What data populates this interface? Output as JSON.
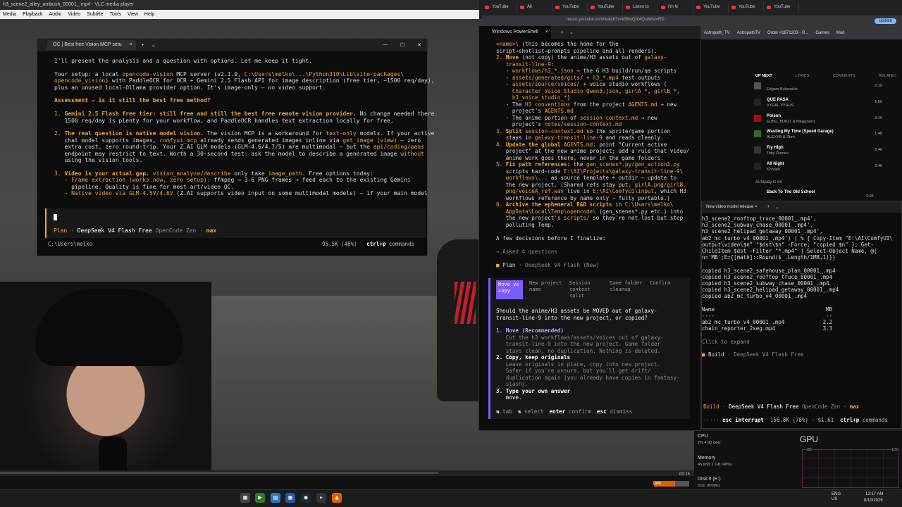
{
  "vlc": {
    "title": "h3_scene2_alley_ambush_00001_.mp4 - VLC media player",
    "menu": [
      "Media",
      "Playback",
      "Audio",
      "Video",
      "Subtitle",
      "Tools",
      "View",
      "Help"
    ],
    "time": "00:15",
    "volume": "100%"
  },
  "oc_window": {
    "tab": "OC | Best free Vision MCP setu",
    "body": [
      [
        {
          "t": "I'll present the analysis and a question with options. Let me keep it tight.",
          "c": ""
        }
      ],
      [
        {
          "t": "",
          "c": ""
        }
      ],
      [
        {
          "t": "Your setup: a local ",
          "c": ""
        },
        {
          "t": "opencode-vision",
          "c": "o"
        },
        {
          "t": " MCP server (v2.1.0, ",
          "c": ""
        },
        {
          "t": "C:\\Users\\melko\\...\\Python310\\Lib\\site-packages\\",
          "c": "o"
        }
      ],
      [
        {
          "t": "opencode_vision",
          "c": "o"
        },
        {
          "t": ") with PaddleOCR for OCR + Gemini 2.5 Flash API for image description (free tier, ~1500 req/day),",
          "c": ""
        }
      ],
      [
        {
          "t": "plus an unused local-Ollama provider option. It's image-only — no video support.",
          "c": ""
        }
      ],
      [
        {
          "t": "",
          "c": ""
        }
      ],
      [
        {
          "t": "Assessment — is it still the best free method?",
          "c": "o b"
        }
      ],
      [
        {
          "t": "",
          "c": ""
        }
      ],
      [
        {
          "t": "1. ",
          "c": "o"
        },
        {
          "t": "Gemini 2.5 Flash free tier: still free and still the best free remote vision provider.",
          "c": "o b"
        },
        {
          "t": " No change needed there.",
          "c": ""
        }
      ],
      [
        {
          "t": "   1500 req/day is plenty for your workflow, and PaddleOCR handles text extraction locally for free.",
          "c": ""
        }
      ],
      [
        {
          "t": "",
          "c": ""
        }
      ],
      [
        {
          "t": "2. ",
          "c": "o"
        },
        {
          "t": "The real question is native model vision.",
          "c": "o b"
        },
        {
          "t": " The vision MCP is a workaround for ",
          "c": ""
        },
        {
          "t": "text-only",
          "c": "o"
        },
        {
          "t": " models. If your active",
          "c": ""
        }
      ],
      [
        {
          "t": "   chat model supports images, ",
          "c": ""
        },
        {
          "t": "comfyui_mcp",
          "c": "o"
        },
        {
          "t": " already sends generated images inline via ",
          "c": ""
        },
        {
          "t": "get_image (view)",
          "c": "o"
        },
        {
          "t": " — zero",
          "c": ""
        }
      ],
      [
        {
          "t": "   extra cost, zero round-trip. Your Z.AI GLM models (GLM-4.6/4.7/5) are multimodal — but the ",
          "c": ""
        },
        {
          "t": "api/coding/paas",
          "c": "o"
        }
      ],
      [
        {
          "t": "   endpoint may restrict to text. Worth a 30-second test: ask the model to describe a generated image ",
          "c": ""
        },
        {
          "t": "without",
          "c": "o"
        }
      ],
      [
        {
          "t": "   using the vision tools.",
          "c": ""
        }
      ],
      [
        {
          "t": "",
          "c": ""
        }
      ],
      [
        {
          "t": "3. ",
          "c": "o"
        },
        {
          "t": "Video is your actual gap.",
          "c": "o b"
        },
        {
          "t": " ",
          "c": ""
        },
        {
          "t": "vision_analyze/describe",
          "c": "o"
        },
        {
          "t": " only take ",
          "c": ""
        },
        {
          "t": "image_path",
          "c": "o"
        },
        {
          "t": ". Free options today:",
          "c": ""
        }
      ],
      [
        {
          "t": "   - ",
          "c": ""
        },
        {
          "t": "Frame extraction (works now, zero setup):",
          "c": "o"
        },
        {
          "t": " ffmpeg → 3-6 PNG frames → feed each to the existing Gemini",
          "c": ""
        }
      ],
      [
        {
          "t": "     pipeline. Quality is fine for most art/video QC.",
          "c": ""
        }
      ],
      [
        {
          "t": "   - ",
          "c": ""
        },
        {
          "t": "Native video via GLM-4.5V/4.6V",
          "c": "o"
        },
        {
          "t": " (Z.AI supports video input on some multimodal models) — if your main model",
          "c": ""
        }
      ]
    ],
    "mode": "Plan",
    "model": "DeepSeek V4 Flash Free",
    "provider": "OpenCode Zen",
    "variant": "max",
    "cwd": "C:\\Users\\melko",
    "context": "95.5K (48%)",
    "shortcut": "ctrl+p",
    "shortcut_label": "commands"
  },
  "ps_window": {
    "tab": "Windows PowerShell",
    "body": [
      [
        {
          "t": "<name>\\",
          "c": "o"
        },
        {
          "t": " (this becomes the home for the",
          "c": ""
        }
      ],
      [
        {
          "t": "script→shotlist→prompts pipeline and all renders).",
          "c": ""
        }
      ],
      [
        {
          "t": "2. ",
          "c": "o"
        },
        {
          "t": "Move",
          "c": "o b"
        },
        {
          "t": " (not copy) the anime/H3 assets out of ",
          "c": ""
        },
        {
          "t": "galaxy-",
          "c": "o"
        }
      ],
      [
        {
          "t": "   transit-line-9",
          "c": "o"
        },
        {
          "t": ":",
          "c": ""
        }
      ],
      [
        {
          "t": "   - ",
          "c": ""
        },
        {
          "t": "workflows/h3_*.json",
          "c": "o"
        },
        {
          "t": " → the 6 H3 build/run/qa scripts",
          "c": ""
        }
      ],
      [
        {
          "t": "   - ",
          "c": ""
        },
        {
          "t": "assets/generated/gits/",
          "c": "o"
        },
        {
          "t": " + ",
          "c": ""
        },
        {
          "t": "h3_*.mp4",
          "c": "o"
        },
        {
          "t": " test outputs",
          "c": ""
        }
      ],
      [
        {
          "t": "   - ",
          "c": ""
        },
        {
          "t": "assets/source/voices/",
          "c": "o"
        },
        {
          "t": " + voice studio workflows (",
          "c": ""
        }
      ],
      [
        {
          "t": "     Character_Voice_Studio_Qwen3.json",
          "c": "o"
        },
        {
          "t": ", ",
          "c": ""
        },
        {
          "t": "girlA_*",
          "c": "o"
        },
        {
          "t": ", ",
          "c": ""
        },
        {
          "t": "girlB_*",
          "c": "o"
        },
        {
          "t": ",",
          "c": ""
        }
      ],
      [
        {
          "t": "     h3_voice_studio_*",
          "c": "o"
        },
        {
          "t": ")",
          "c": ""
        }
      ],
      [
        {
          "t": "   - The ",
          "c": ""
        },
        {
          "t": "H3 conventions",
          "c": "o"
        },
        {
          "t": " from the project ",
          "c": ""
        },
        {
          "t": "AGENTS.md",
          "c": "o"
        },
        {
          "t": " → new",
          "c": ""
        }
      ],
      [
        {
          "t": "     project's ",
          "c": ""
        },
        {
          "t": "AGENTS.md",
          "c": "o"
        }
      ],
      [
        {
          "t": "   - The anime portion of ",
          "c": ""
        },
        {
          "t": "session-context.md",
          "c": "o"
        },
        {
          "t": " → new",
          "c": ""
        }
      ],
      [
        {
          "t": "     project's ",
          "c": ""
        },
        {
          "t": "notes/session-context.md",
          "c": "o"
        }
      ],
      [
        {
          "t": "3. ",
          "c": "o"
        },
        {
          "t": "Split ",
          "c": "o b"
        },
        {
          "t": "session-context.md",
          "c": "o"
        },
        {
          "t": " so the sprite/game portion",
          "c": ""
        }
      ],
      [
        {
          "t": "   stays in ",
          "c": ""
        },
        {
          "t": "galaxy-transit-line-9",
          "c": "o"
        },
        {
          "t": " and reads cleanly.",
          "c": ""
        }
      ],
      [
        {
          "t": "4. ",
          "c": "o"
        },
        {
          "t": "Update the global ",
          "c": "o b"
        },
        {
          "t": "AGENTS.md",
          "c": "o"
        },
        {
          "t": ": point \"Current active",
          "c": ""
        }
      ],
      [
        {
          "t": "   project\" at the new anime project; add a rule that video/",
          "c": ""
        }
      ],
      [
        {
          "t": "   anime work goes there, never in the game folders.",
          "c": ""
        }
      ],
      [
        {
          "t": "5. ",
          "c": "o"
        },
        {
          "t": "Fix path references:",
          "c": "o b"
        },
        {
          "t": " the ",
          "c": ""
        },
        {
          "t": "gen_scenes*.py/gen_action3.py",
          "c": "o"
        }
      ],
      [
        {
          "t": "   scripts hard-code ",
          "c": ""
        },
        {
          "t": "E:\\AI\\Projects\\galaxy-transit-line-9\\",
          "c": "o"
        }
      ],
      [
        {
          "t": "   workflows\\...",
          "c": "o"
        },
        {
          "t": " as source template + outdir — update to",
          "c": ""
        }
      ],
      [
        {
          "t": "   the new project. (Shared refs stay put: ",
          "c": ""
        },
        {
          "t": "girlA.png/girlB.",
          "c": "o"
        }
      ],
      [
        {
          "t": "   png/voiceA_ref.wav",
          "c": "o"
        },
        {
          "t": " live in ",
          "c": ""
        },
        {
          "t": "E:\\AI\\ComfyUI\\input",
          "c": "o"
        },
        {
          "t": ", which H3",
          "c": ""
        }
      ],
      [
        {
          "t": "   workflows reference by name only — fully portable.)",
          "c": ""
        }
      ],
      [
        {
          "t": "6. ",
          "c": "o"
        },
        {
          "t": "Archive the ephemeral R&D scripts",
          "c": "o b"
        },
        {
          "t": " in ",
          "c": ""
        },
        {
          "t": "C:\\Users\\melko\\",
          "c": "o"
        }
      ],
      [
        {
          "t": "   AppData\\Local\\Temp\\opencode\\",
          "c": "o"
        },
        {
          "t": " (gen_scenes*.py etc.) into",
          "c": ""
        }
      ],
      [
        {
          "t": "   the new project's ",
          "c": ""
        },
        {
          "t": "scripts/",
          "c": "o"
        },
        {
          "t": " so they're not lost but stop",
          "c": ""
        }
      ],
      [
        {
          "t": "   polluting Temp.",
          "c": ""
        }
      ],
      [
        {
          "t": "",
          "c": ""
        }
      ],
      [
        {
          "t": "A few decisions before I finalize:",
          "c": ""
        }
      ],
      [
        {
          "t": "",
          "c": ""
        }
      ],
      [
        {
          "t": "→ Asked 4 questions",
          "c": "dim"
        }
      ],
      [
        {
          "t": "",
          "c": ""
        }
      ],
      [
        {
          "t": "■ ",
          "c": "o"
        },
        {
          "t": "Plan",
          "c": ""
        },
        {
          "t": " · DeepSeek V4 Flash (New)",
          "c": "dim"
        }
      ]
    ],
    "q_tabs": [
      "Move vs copy",
      "New project name",
      "Session context split",
      "Game folder cleanup",
      "Confirm"
    ],
    "question": "Should the anime/H3 assets be MOVED out of galaxy-\ntransit-line-9 into the new project, or copied?",
    "options": [
      {
        "label": "1. Move (Recommended)",
        "desc": "   Cut the h3 workflows/assets/voices out of galaxy-\n   transit-line-9 into the new project. Game folder\n   stays clean, no duplication. Nothing is deleted."
      },
      {
        "label": "2. Copy, keep originals",
        "desc": "   Leave originals in place, copy into new project.\n   Safer if you're unsure, but you'll get drift/\n   duplication again (you already have copies in fantasy-\n   slash)."
      },
      {
        "label": "3. Type your own answer",
        "desc": "   move."
      }
    ],
    "hints": [
      {
        "key": "⇆",
        "label": "tab"
      },
      {
        "key": "⇅",
        "label": "select"
      },
      {
        "key": "enter",
        "label": "confirm"
      },
      {
        "key": "esc",
        "label": "dismiss"
      }
    ]
  },
  "browser": {
    "tabs": [
      "YouTube",
      "All",
      "YouTube",
      "YouTube",
      "Listen to",
      "I'm N",
      "YouTube",
      "YouTube",
      "YouTube"
    ],
    "url": "music.youtube.com/watch?v=k9NoQiX4Qsl&list=RD",
    "bookmarks": [
      "Astropath_TV",
      "AstropathTV",
      "Order #1871203 - R...",
      "Games",
      "Mod"
    ],
    "update_label": "Update",
    "yt_tabs": [
      "UP NEXT",
      "LYRICS",
      "COMMENTS",
      "RELATED"
    ],
    "queue": [
      {
        "title": "",
        "artist": "Edgars Bukovskis",
        "dur": "2:19"
      },
      {
        "title": "QUE PASA",
        "artist": "VYRAL VYRUS",
        "dur": "1:50"
      },
      {
        "title": "Poison",
        "artist": "EDBU, BUKO, & Megazvers",
        "dur": "3:10"
      },
      {
        "title": "Wasting My Time (Speed Garage)",
        "artist": "ALEXYB & Strm.",
        "dur": "1:48"
      },
      {
        "title": "Fly High",
        "artist": "Toby Romeo",
        "dur": "2:46"
      },
      {
        "title": "All Night",
        "artist": "Korvath",
        "dur": "3:46"
      }
    ],
    "autoplay": "Autoplay is on",
    "autoplay_next": "Back To The Old School",
    "autoplay_dur": "2:06"
  },
  "t2": {
    "tab": "New video model release",
    "body": [
      [
        {
          "t": "h3_scene2_rooftop_truce_00001_.mp4',",
          "c": ""
        }
      ],
      [
        {
          "t": "h3_scene2_subway_chase_00001_.mp4',",
          "c": ""
        }
      ],
      [
        {
          "t": "h3_scene2_helipad_getaway_00001_.mp4',",
          "c": ""
        }
      ],
      [
        {
          "t": "ab2_mc_turbo_v4_00001_.mp4') | % { Copy-Item \"E:\\AI\\ComfyUI\\",
          "c": ""
        }
      ],
      [
        {
          "t": "output\\video\\$n\" \"$dst\\$n\" -Force; \"copied $n\" }; Get-",
          "c": ""
        }
      ],
      [
        {
          "t": "ChildItem $dst -Filter \"*.mp4\" | Select-Object Name, @{",
          "c": ""
        }
      ],
      [
        {
          "t": "n='MB';E={[math]::Round($_.Length/1MB,1)}}",
          "c": ""
        }
      ],
      [
        {
          "t": "",
          "c": ""
        }
      ],
      [
        {
          "t": "copied h3_scene2_safehouse_plan_00001_.mp4",
          "c": ""
        }
      ],
      [
        {
          "t": "copied h3_scene2_rooftop_truce_00001_.mp4",
          "c": ""
        }
      ],
      [
        {
          "t": "copied h3_scene2_subway_chase_00001_.mp4",
          "c": ""
        }
      ],
      [
        {
          "t": "copied h3_scene2_helipad_getaway_00001_.mp4",
          "c": ""
        }
      ],
      [
        {
          "t": "copied ab2_mc_turbo_v4_00001_.mp4",
          "c": ""
        }
      ],
      [
        {
          "t": "",
          "c": ""
        }
      ],
      [
        {
          "t": "Name                                   MB",
          "c": ""
        }
      ],
      [
        {
          "t": "----                                   --",
          "c": ""
        }
      ],
      [
        {
          "t": "ab2_mc_turbo_v4_00001_.mp4            2.2",
          "c": ""
        }
      ],
      [
        {
          "t": "chain_reporter_2seg.mp4               3.3",
          "c": ""
        }
      ],
      [
        {
          "t": "",
          "c": ""
        }
      ],
      [
        {
          "t": "Click to expand",
          "c": "dim"
        }
      ],
      [
        {
          "t": "",
          "c": ""
        }
      ],
      [
        {
          "t": "■ ",
          "c": "o"
        },
        {
          "t": "Build",
          "c": ""
        },
        {
          "t": " · DeepSeek V4 Flash Free",
          "c": "dim"
        }
      ]
    ],
    "mode": "Build",
    "model": "DeepSeek V4 Flash Free",
    "provider": "OpenCode Zen",
    "variant": "max",
    "status_interrupt": "esc interrupt",
    "context": "156.8K (78%)",
    "cost": "$1.61",
    "shortcut": "ctrl+p",
    "shortcut_label": "commands"
  },
  "taskmgr": {
    "cpu_label": "CPU",
    "cpu_sub": "2% 4.90 GHz",
    "mem_label": "Memory",
    "mem_sub": "45.9/95.1 GB (48%)",
    "disk_label": "Disk 0 (E:)",
    "disk_sub": "SSD (NVMe)",
    "gpu_title": "GPU",
    "gpu_graph_label": "3D",
    "gpu_pct": "12%"
  },
  "taskbar": {
    "lang": "ENG\nUS",
    "time": "12:17 AM",
    "date": "8/10/2026"
  },
  "colors": {
    "accent": "#f0a040",
    "purple": "#7d5cff",
    "vlc_orange": "#e06000"
  }
}
